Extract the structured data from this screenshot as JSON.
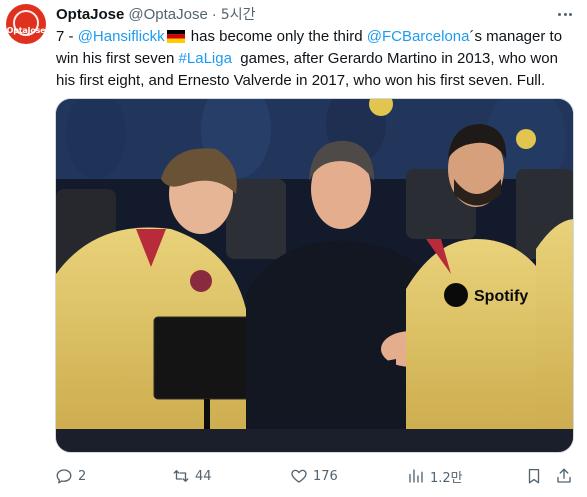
{
  "author": {
    "name": "OptaJose",
    "handle": "@OptaJose",
    "time": "5시간",
    "avatar_text": "OptaJose"
  },
  "tweet": {
    "line1_pre": "7 - ",
    "mention_flick": "@Hansiflickk",
    "line1_mid": " has become only the third ",
    "mention_barca": "@FCBarcelona",
    "line1_post": "´s manager to",
    "line2_pre": "win his first seven ",
    "hashtag": "#LaLiga",
    "line2_post": "  games, after Gerardo Martino in 2013, who won",
    "line3": "his first eight, and Ernesto Valverde in 2017, who won his first seven. Full."
  },
  "media": {
    "icon": "photo",
    "sponsor_text": "Spotify"
  },
  "actions": {
    "replies": "2",
    "retweets": "44",
    "likes": "176",
    "views": "1.2만"
  },
  "colors": {
    "link": "#1d9bf0",
    "secondary_text": "#536471",
    "avatar_bg": "#e0301e"
  }
}
